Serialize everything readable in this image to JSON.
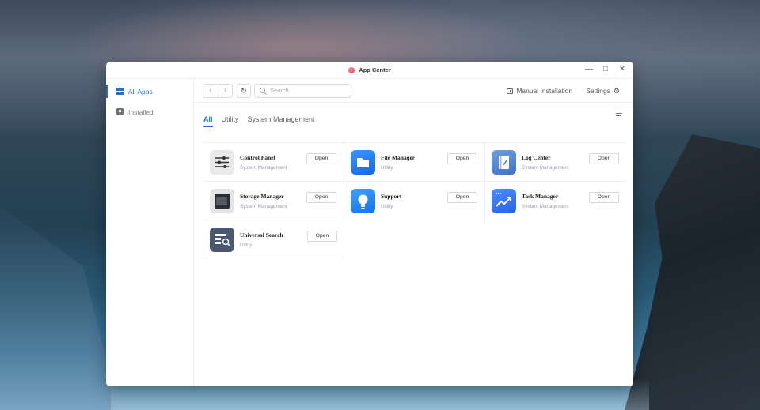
{
  "window": {
    "title": "App Center",
    "controls": [
      "minimize",
      "maximize",
      "close"
    ]
  },
  "sidebar": {
    "items": [
      {
        "label": "All Apps",
        "icon": "grid-icon",
        "active": true
      },
      {
        "label": "Installed",
        "icon": "installed-icon",
        "active": false
      }
    ]
  },
  "toolbar": {
    "search_placeholder": "Search",
    "manual_installation": "Manual Installation",
    "settings": "Settings"
  },
  "tabs": [
    {
      "label": "All",
      "active": true
    },
    {
      "label": "Utility",
      "active": false
    },
    {
      "label": "System Management",
      "active": false
    }
  ],
  "apps": [
    {
      "name": "Control Panel",
      "category": "System Management",
      "button": "Open",
      "icon": "control-panel-icon"
    },
    {
      "name": "File Manager",
      "category": "Utility",
      "button": "Open",
      "icon": "file-manager-icon"
    },
    {
      "name": "Log Center",
      "category": "System Management",
      "button": "Open",
      "icon": "log-center-icon"
    },
    {
      "name": "Storage Manager",
      "category": "System Management",
      "button": "Open",
      "icon": "storage-manager-icon"
    },
    {
      "name": "Support",
      "category": "Utility",
      "button": "Open",
      "icon": "support-icon"
    },
    {
      "name": "Task Manager",
      "category": "System Management",
      "button": "Open",
      "icon": "task-manager-icon"
    },
    {
      "name": "Universal Search",
      "category": "Utility",
      "button": "Open",
      "icon": "universal-search-icon"
    }
  ],
  "colors": {
    "accent": "#1f6fd8"
  }
}
